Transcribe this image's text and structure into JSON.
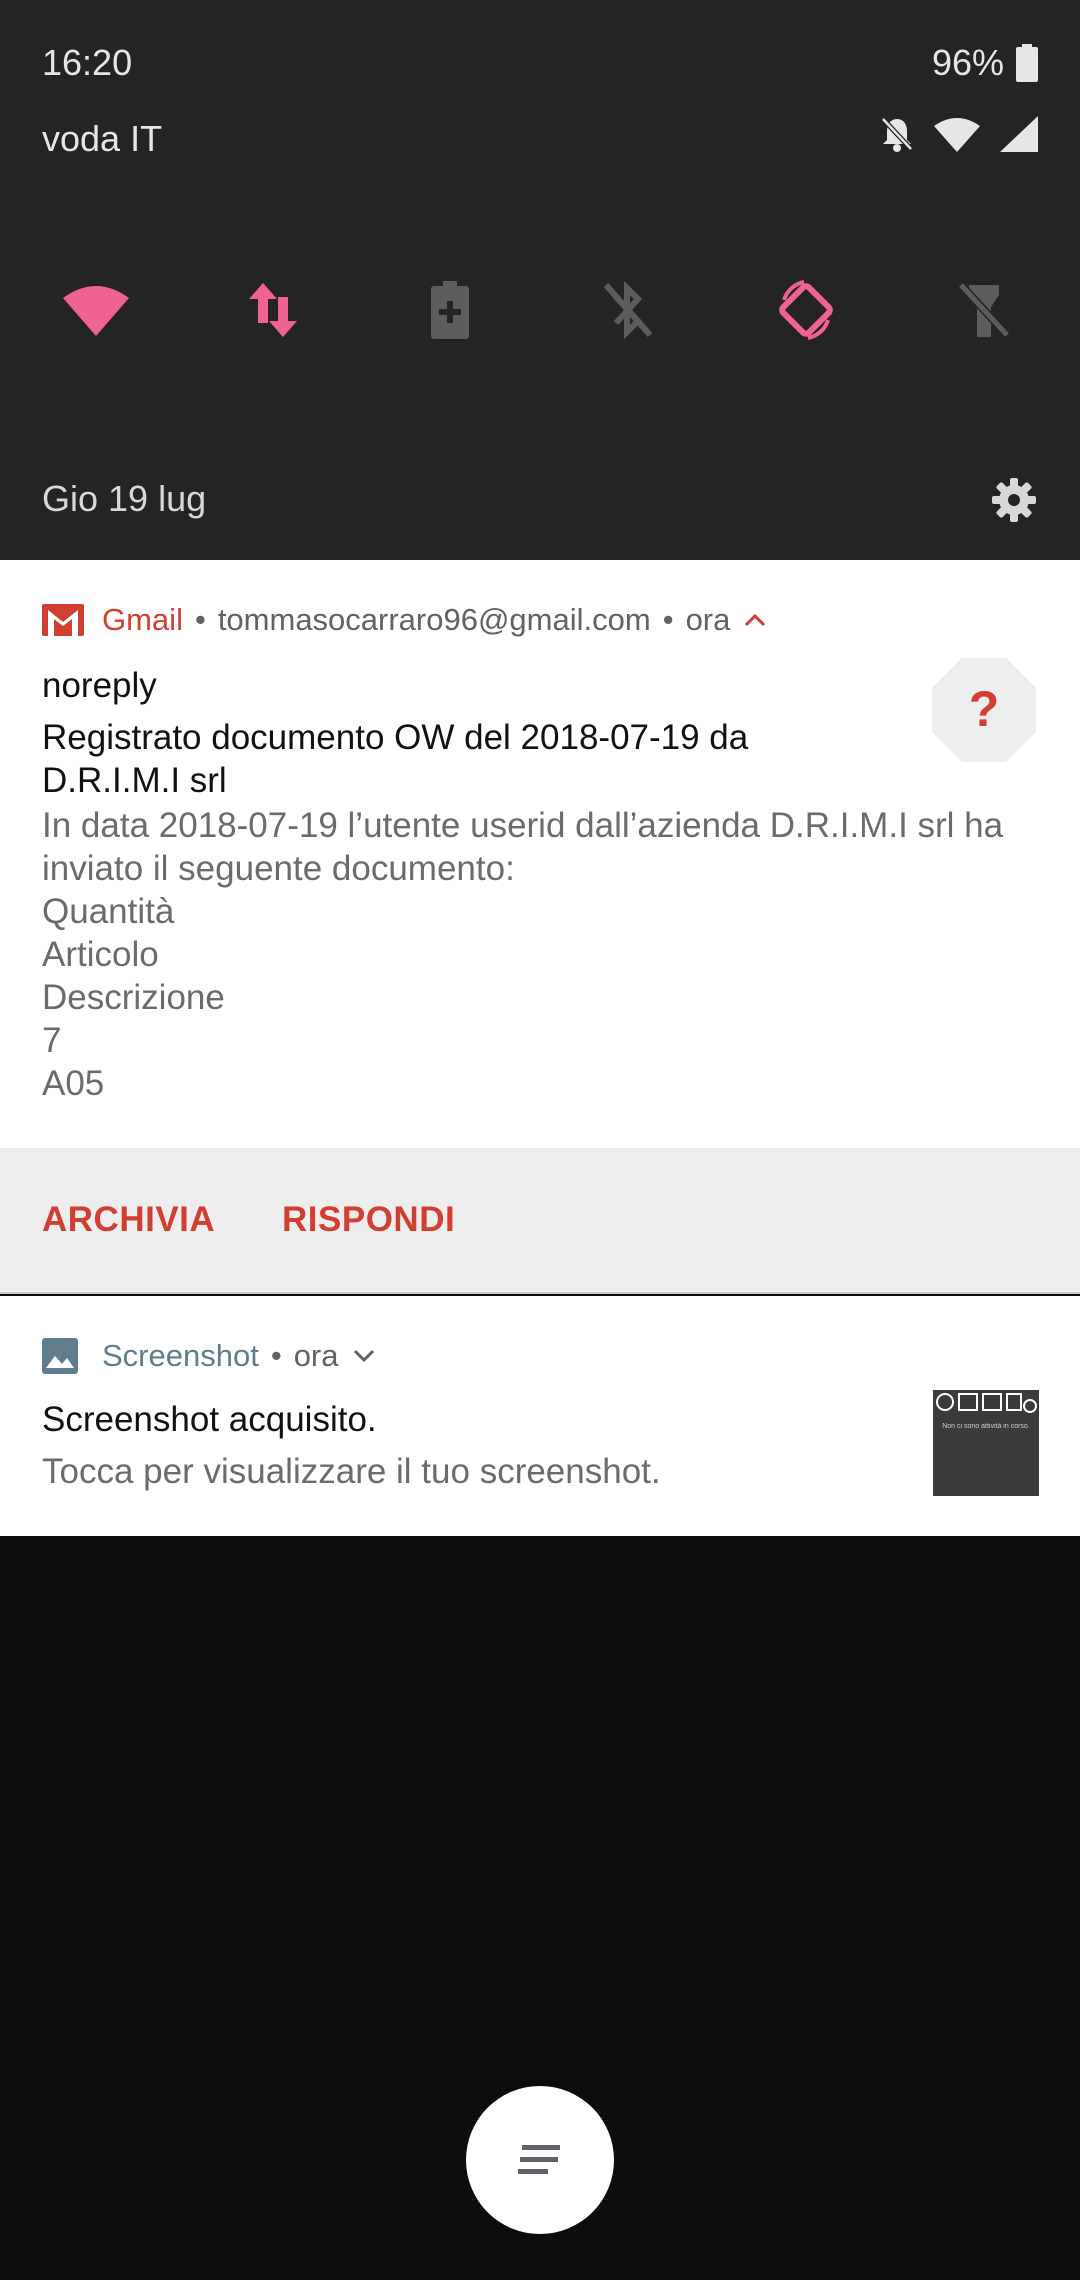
{
  "status_bar": {
    "time": "16:20",
    "battery": "96%",
    "carrier": "voda IT",
    "icons": [
      "battery-icon",
      "bell-off-icon",
      "wifi-signal-icon",
      "cell-signal-icon"
    ]
  },
  "quick_tiles": [
    {
      "name": "wifi-tile",
      "icon": "wifi-icon",
      "active": true
    },
    {
      "name": "mobile-data-tile",
      "icon": "data-arrows-icon",
      "active": true
    },
    {
      "name": "battery-saver-tile",
      "icon": "battery-plus-icon",
      "active": false
    },
    {
      "name": "bluetooth-tile",
      "icon": "bluetooth-off-icon",
      "active": false
    },
    {
      "name": "auto-rotate-tile",
      "icon": "rotate-icon",
      "active": true
    },
    {
      "name": "flashlight-tile",
      "icon": "flashlight-off-icon",
      "active": false
    }
  ],
  "date": "Gio 19 lug",
  "colors": {
    "accent_pink": "#f0628f",
    "gmail_red": "#d23f31",
    "panel_bg": "#242424",
    "inactive_icon": "#5c5c5c"
  },
  "gmail_notification": {
    "app_name": "Gmail",
    "account": "tommasocarraro96@gmail.com",
    "time": "ora",
    "sender": "noreply",
    "subject": "Registrato documento OW del 2018-07-19 da D.R.I.M.I srl",
    "body_lines": [
      "In data 2018-07-19 l’utente userid dall’azienda D.R.I.M.I srl ha",
      "inviato il seguente documento:",
      "Quantità",
      "Articolo",
      "Descrizione",
      "7",
      "A05"
    ],
    "avatar_symbol": "?",
    "actions": {
      "archive": "ARCHIVIA",
      "reply": "RISPONDI"
    }
  },
  "screenshot_notification": {
    "app_name": "Screenshot",
    "time": "ora",
    "title": "Screenshot acquisito.",
    "text": "Tocca per visualizzare il tuo screenshot.",
    "thumbnail_caption": "Non ci sono attività in corso."
  }
}
